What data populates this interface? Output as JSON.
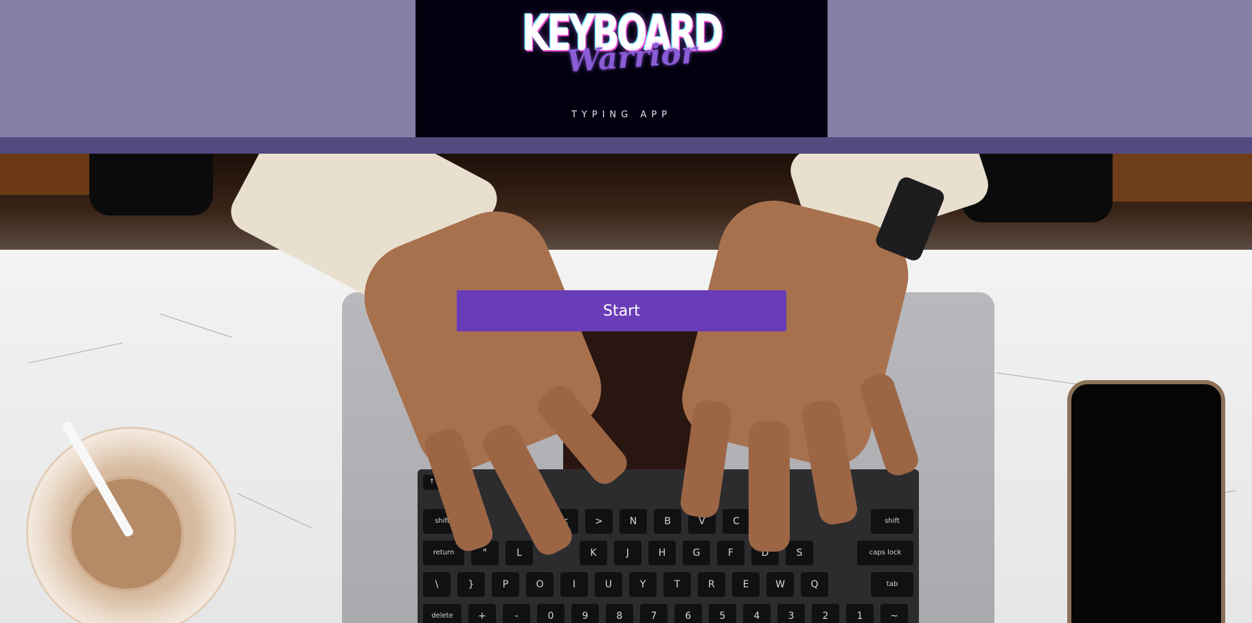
{
  "header": {
    "logo": {
      "title": "KEYBOARD",
      "script": "Warrior",
      "tagline": "TYPING APP"
    }
  },
  "main": {
    "start_label": "Start"
  },
  "keyboard": {
    "row_top": [
      "↑",
      "shift",
      "<",
      ">",
      "N",
      "B",
      "V",
      "C",
      "shift"
    ],
    "row_home": [
      "return",
      "\"",
      "L",
      "K",
      "J",
      "H",
      "G",
      "F",
      "D",
      "S",
      "caps lock"
    ],
    "row_q": [
      "\\",
      "}",
      "P",
      "O",
      "I",
      "U",
      "Y",
      "T",
      "R",
      "E",
      "W",
      "Q",
      "tab"
    ],
    "row_num": [
      "delete",
      "+",
      "-",
      "0",
      "9",
      "8",
      "7",
      "6",
      "5",
      "4",
      "3",
      "2",
      "1",
      "~"
    ]
  },
  "colors": {
    "header_bg": "#8580a6",
    "header_strip": "#544a80",
    "logo_bg": "#02000f",
    "accent": "#6a3db8"
  }
}
